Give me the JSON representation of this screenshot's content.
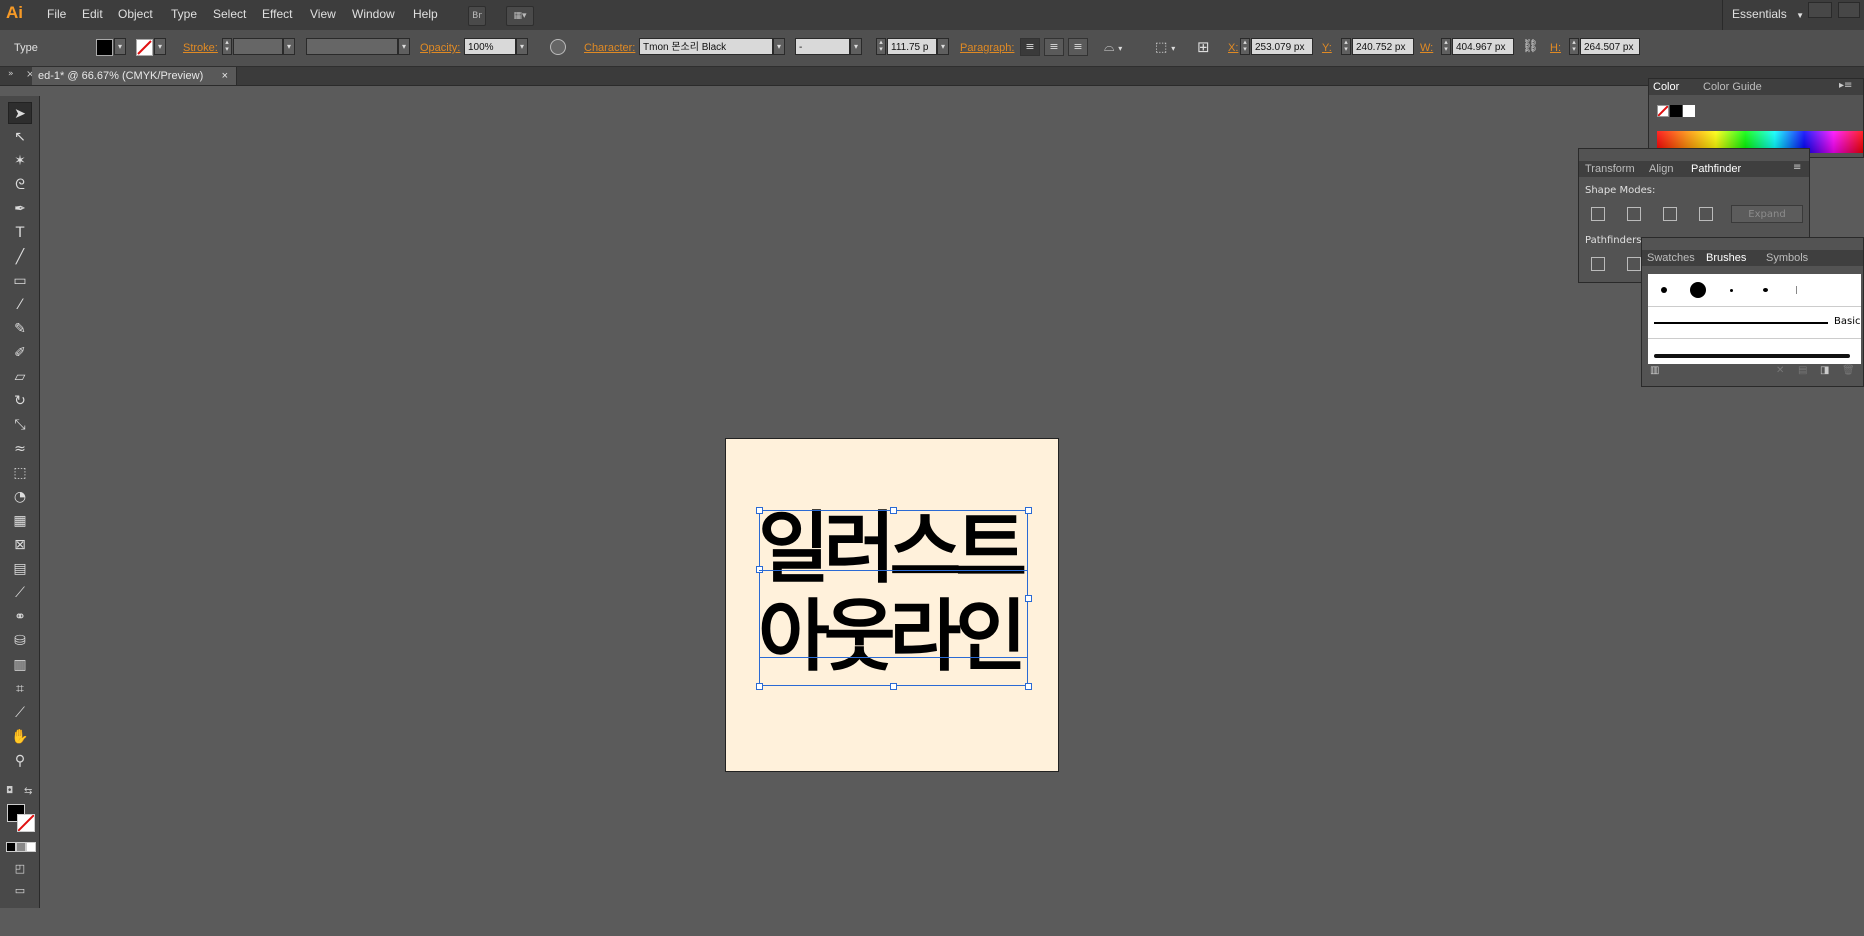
{
  "app": {
    "logo": "Ai"
  },
  "menu": {
    "items": [
      "File",
      "Edit",
      "Object",
      "Type",
      "Select",
      "Effect",
      "View",
      "Window",
      "Help"
    ],
    "bridge_label": "Br",
    "workspace": "Essentials"
  },
  "control": {
    "mode": "Type",
    "stroke_label": "Stroke:",
    "opacity_label": "Opacity:",
    "opacity_value": "100%",
    "character_label": "Character:",
    "font_family": "Tmon 몬소리 Black",
    "font_style": "-",
    "font_size": "111.75 p",
    "paragraph_label": "Paragraph:",
    "x_label": "X:",
    "x_value": "253.079 px",
    "y_label": "Y:",
    "y_value": "240.752 px",
    "w_label": "W:",
    "w_value": "404.967 px",
    "h_label": "H:",
    "h_value": "264.507 px"
  },
  "document": {
    "tab_title": "ed-1* @ 66.67% (CMYK/Preview)"
  },
  "artwork": {
    "line1": "일러스트",
    "line2": "아웃라인",
    "artboard_color": "#fff1db"
  },
  "panels": {
    "color": {
      "tabs": [
        "Color",
        "Color Guide"
      ]
    },
    "pathfinder": {
      "tabs": [
        "Transform",
        "Align",
        "Pathfinder"
      ],
      "shape_modes_label": "Shape Modes:",
      "pathfinders_label": "Pathfinders:",
      "expand_label": "Expand"
    },
    "brushes": {
      "tabs": [
        "Swatches",
        "Brushes",
        "Symbols"
      ],
      "basic_label": "Basic"
    }
  },
  "colors": {
    "accent": "#e08a24",
    "selection": "#2a6ad4",
    "canvas": "#5b5b5b"
  }
}
